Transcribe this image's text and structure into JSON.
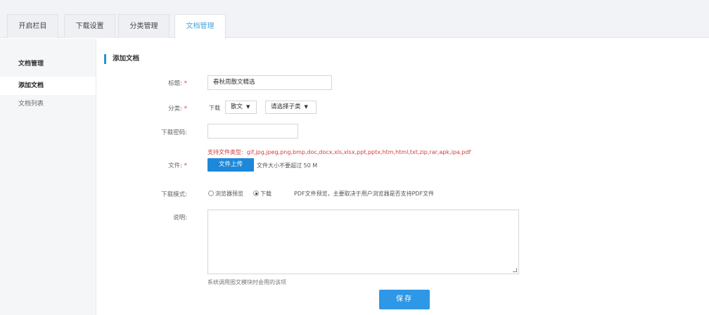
{
  "tabs": [
    {
      "label": "开启栏目"
    },
    {
      "label": "下载设置"
    },
    {
      "label": "分类管理"
    },
    {
      "label": "文档管理"
    }
  ],
  "sidebar": {
    "title": "文档管理",
    "items": [
      {
        "label": "添加文档",
        "active": true
      },
      {
        "label": "文档列表",
        "active": false
      }
    ]
  },
  "content": {
    "section_title": "添加文档",
    "form": {
      "title_label": "标题:",
      "title_value": "春秋周散文精选",
      "category_label": "分类:",
      "category_prefix": "下载",
      "category_value": "散文",
      "subcategory_value": "请选择子类",
      "password_label": "下载密码:",
      "password_value": "",
      "file_label": "文件:",
      "file_types_label": "支持文件类型:",
      "file_types_value": "gif,jpg,jpeg,png,bmp,doc,docx,xls,xlsx,ppt,pptx,htm,html,txt,zip,rar,apk,ipa,pdf",
      "upload_button": "文件上传",
      "size_limit": "文件大小不要超过 50 M",
      "mode_label": "下载模式:",
      "mode_option_browser": "浏览器预览",
      "mode_option_download": "下载",
      "mode_selected": "下载",
      "mode_note": "PDF文件预览，主要取决于用户浏览器是否支持PDF文件",
      "desc_label": "说明:",
      "desc_value": "",
      "desc_hint": "系统调用图文模块时会用的该项",
      "save_button": "保存"
    }
  },
  "colors": {
    "accent": "#2e97e6",
    "active_tab_text": "#4aa3df",
    "required": "#e03a3a",
    "file_types": "#d23c3c"
  }
}
